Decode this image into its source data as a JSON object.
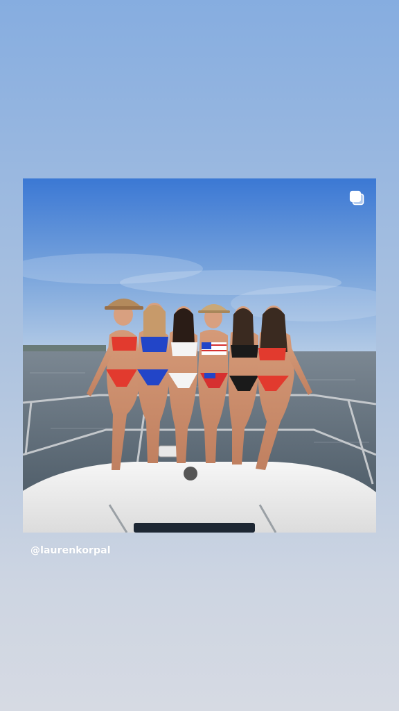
{
  "story": {
    "mention": "@laurenkorpal",
    "background_gradient": [
      "#86ade0",
      "#d6dae3"
    ]
  },
  "post": {
    "carousel_icon": "carousel-multiple-icon",
    "palette": {
      "sky_top": "#3b78d4",
      "sky_bottom": "#a8c4e6",
      "water": "#5d6e7d",
      "boat_deck": "#f2f2f2",
      "railing": "#c4c8cc",
      "bikini_red": "#e23a2e",
      "bikini_blue": "#2245c8",
      "bikini_white": "#f4f4f4",
      "bikini_black": "#1a1a1a"
    }
  }
}
